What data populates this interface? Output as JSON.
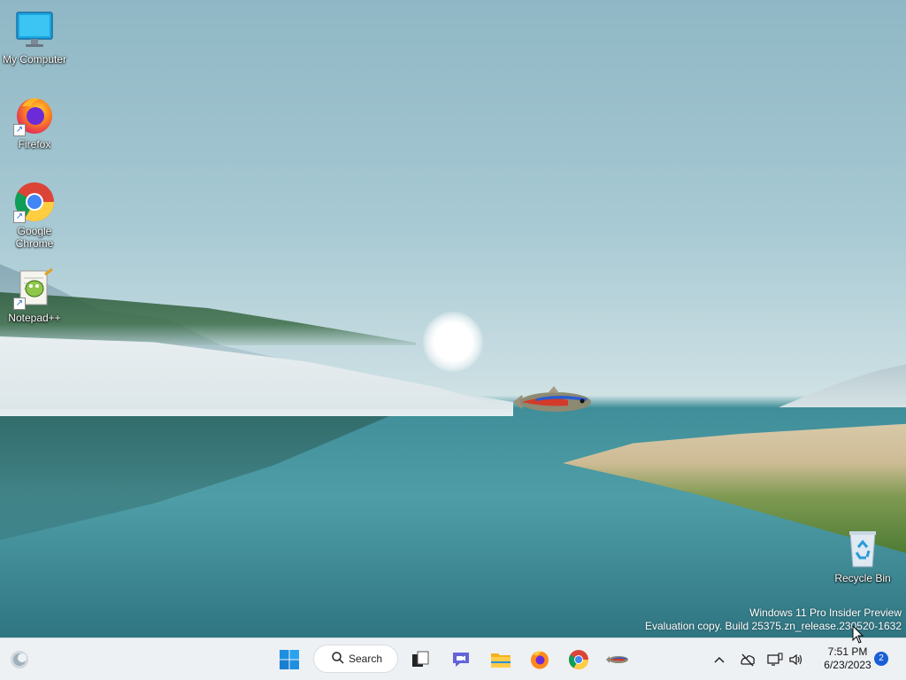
{
  "desktop": {
    "icons": [
      {
        "label": "My Computer",
        "icon": "monitor-icon"
      },
      {
        "label": "Firefox",
        "icon": "firefox-icon"
      },
      {
        "label": "Google\nChrome",
        "icon": "chrome-icon"
      },
      {
        "label": "Notepad++",
        "icon": "notepadpp-icon"
      },
      {
        "label": "Recycle Bin",
        "icon": "recycle-bin-icon"
      }
    ]
  },
  "watermark": {
    "line1": "Windows 11 Pro Insider Preview",
    "line2": "Evaluation copy. Build 25375.zn_release.230520-1632"
  },
  "taskbar": {
    "search_label": "Search",
    "pinned": [
      "windows-start-icon",
      "search-icon",
      "task-view-icon",
      "chat-icon",
      "file-explorer-icon",
      "firefox-icon",
      "chrome-icon",
      "fish-app-icon"
    ],
    "tray": {
      "icons": [
        "chevron-up-icon",
        "network-off-icon",
        "display-icon",
        "speaker-icon"
      ],
      "time": "7:51 PM",
      "date": "6/23/2023",
      "notification_count": "2"
    }
  },
  "colors": {
    "taskbar_bg": "#eef1f4",
    "accent": "#1a5fd6"
  }
}
